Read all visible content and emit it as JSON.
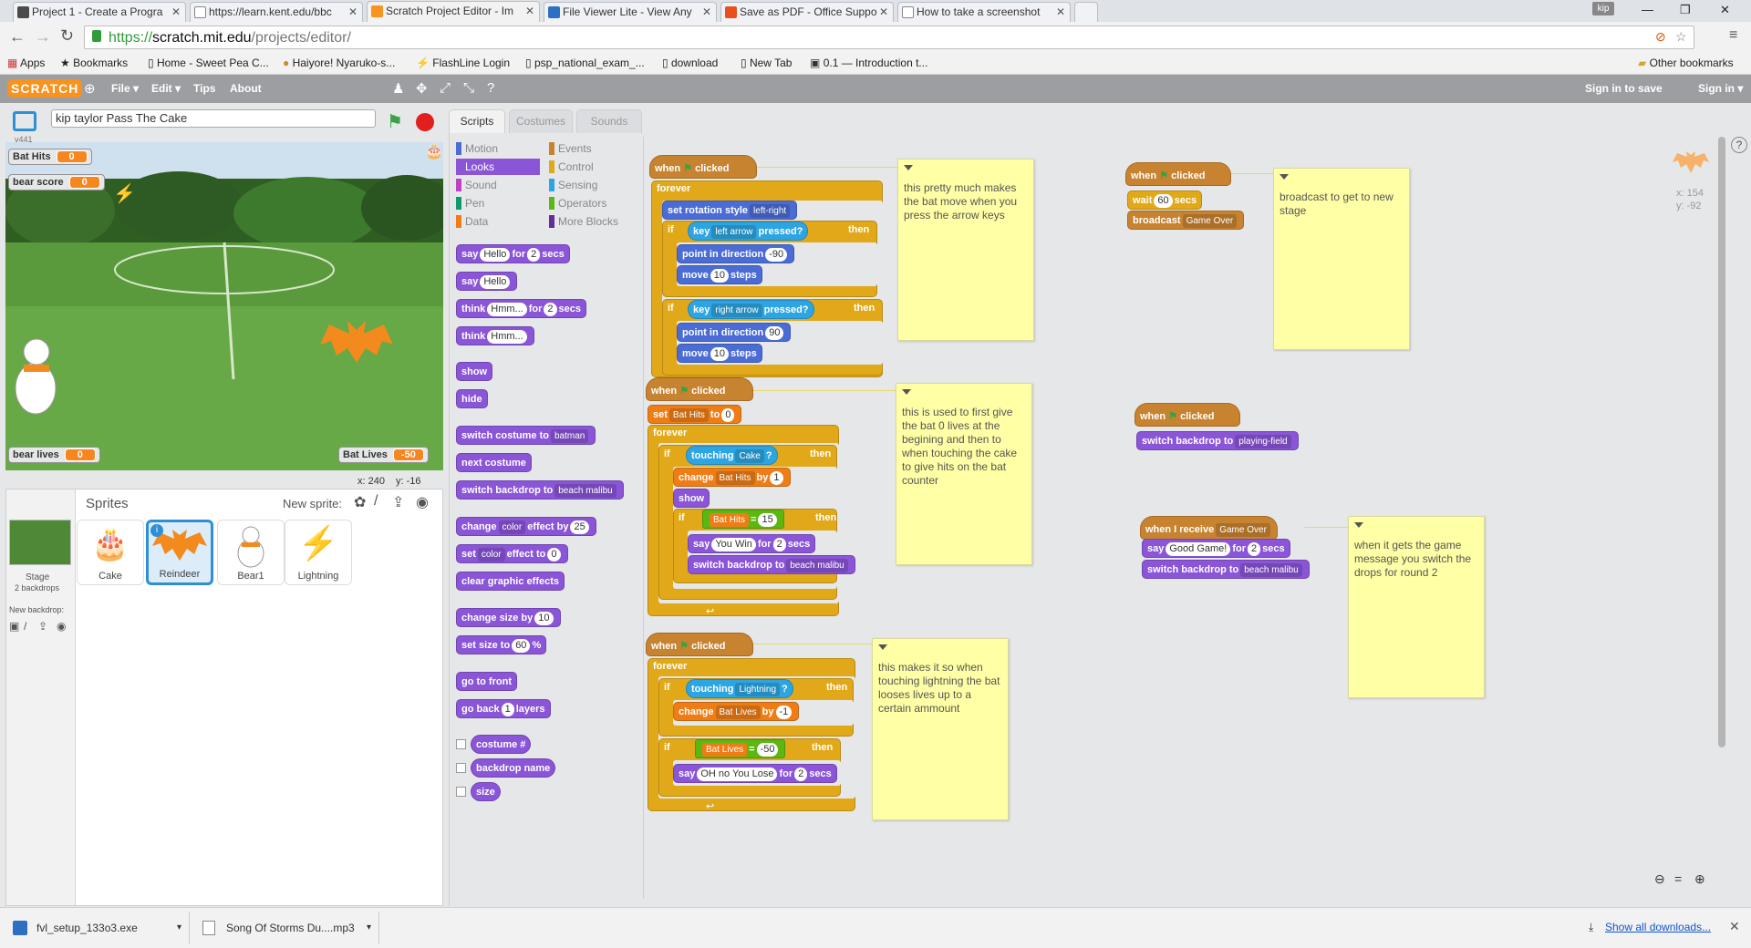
{
  "browser": {
    "tabs": [
      {
        "title": "Project 1 - Create a Progra",
        "fav": "#4a4a4a"
      },
      {
        "title": "https://learn.kent.edu/bbc",
        "fav": "#888"
      },
      {
        "title": "Scratch Project Editor - Im",
        "fav": "#f7931e"
      },
      {
        "title": "File Viewer Lite - View Any",
        "fav": "#2d6fc4"
      },
      {
        "title": "Save as PDF - Office Suppo",
        "fav": "#e8501e"
      },
      {
        "title": "How to take a screenshot",
        "fav": "#888"
      }
    ],
    "user_badge": "kip",
    "url_scheme": "https://",
    "url_host": "scratch.mit.edu",
    "url_path": "/projects/editor/",
    "bookmarks": [
      "Apps",
      "Bookmarks",
      "Home - Sweet Pea C...",
      "Haiyore! Nyaruko-s...",
      "FlashLine Login",
      "psp_national_exam_...",
      "download",
      "New Tab",
      "0.1 — Introduction t..."
    ],
    "other_bookmarks": "Other bookmarks"
  },
  "scratch": {
    "logo": "SCRATCH",
    "menu": [
      "File ▾",
      "Edit ▾",
      "Tips",
      "About"
    ],
    "sign_in_save": "Sign in to save",
    "sign_in": "Sign in ▾",
    "project_title": "kip taylor Pass The Cake",
    "version": "v441",
    "monitors": {
      "bat_hits_label": "Bat Hits",
      "bat_hits_value": "0",
      "bear_score_label": "bear score",
      "bear_score_value": "0",
      "bear_lives_label": "bear lives",
      "bear_lives_value": "0",
      "bat_lives_label": "Bat Lives",
      "bat_lives_value": "-50"
    },
    "stage_coords_x": "x: 240",
    "stage_coords_y": "y: -16",
    "sprites_header": "Sprites",
    "new_sprite": "New sprite:",
    "stage_label": "Stage",
    "stage_backdrops": "2 backdrops",
    "new_backdrop": "New backdrop:",
    "sprites": [
      "Cake",
      "Reindeer",
      "Bear1",
      "Lightning"
    ],
    "tabs": [
      "Scripts",
      "Costumes",
      "Sounds"
    ],
    "categories_left": [
      "Motion",
      "Looks",
      "Sound",
      "Pen",
      "Data"
    ],
    "categories_right": [
      "Events",
      "Control",
      "Sensing",
      "Operators",
      "More Blocks"
    ],
    "cat_colors": {
      "Motion": "#4a6cd4",
      "Looks": "#8a55d7",
      "Sound": "#bb42c3",
      "Pen": "#0e9a6c",
      "Data": "#ee7d16",
      "Events": "#c88330",
      "Control": "#e1a91a",
      "Sensing": "#2ca5e2",
      "Operators": "#5cb712",
      "More Blocks": "#632d99"
    },
    "palette": {
      "say": "say",
      "hello": "Hello",
      "for": "for",
      "two": "2",
      "secs": "secs",
      "think": "think",
      "hmm": "Hmm...",
      "show": "show",
      "hide": "hide",
      "switch_costume": "switch costume to",
      "batman": "batman",
      "next_costume": "next costume",
      "switch_backdrop": "switch backdrop to",
      "beach": "beach malibu",
      "change": "change",
      "color": "color",
      "effect_by": "effect by",
      "n25": "25",
      "set": "set",
      "effect_to": "effect to",
      "n0": "0",
      "clear_effects": "clear graphic effects",
      "change_size": "change size by",
      "n10": "10",
      "set_size": "set size to",
      "n60": "60",
      "pct": "%",
      "go_front": "go to front",
      "go_back": "go back",
      "n1": "1",
      "layers": "layers",
      "costume_num": "costume #",
      "backdrop_name": "backdrop name",
      "size": "size"
    },
    "script1": {
      "when": "when",
      "clicked": "clicked",
      "forever": "forever",
      "set_rotation": "set rotation style",
      "left_right": "left-right",
      "if": "if",
      "key": "key",
      "left_arrow": "left arrow",
      "pressed": "pressed?",
      "then": "then",
      "point_dir": "point in direction",
      "m90": "-90",
      "move": "move",
      "ten": "10",
      "steps": "steps",
      "right_arrow": "right arrow",
      "p90": "90"
    },
    "script2": {
      "set": "set",
      "bat_hits": "Bat Hits",
      "to": "to",
      "zero": "0",
      "touching": "touching",
      "cake": "Cake",
      "q": "?",
      "change": "change",
      "by": "by",
      "one": "1",
      "eq": "=",
      "fifteen": "15",
      "say": "say",
      "you_win": "You Win",
      "for": "for",
      "two": "2",
      "secs": "secs",
      "switch_backdrop": "switch backdrop to",
      "beach": "beach malibu"
    },
    "script3": {
      "lightning": "Lightning",
      "bat_lives": "Bat Lives",
      "m1": "-1",
      "m50": "-50",
      "oh_no": "OH no You Lose"
    },
    "script4": {
      "wait": "wait",
      "sixty": "60",
      "secs": "secs",
      "broadcast": "broadcast",
      "game_over": "Game Over"
    },
    "script5": {
      "switch_backdrop": "switch backdrop to",
      "playing_field": "playing-field"
    },
    "script6": {
      "when_receive": "when I receive",
      "game_over": "Game Over",
      "say": "say",
      "good_game": "Good Game!",
      "for": "for",
      "two": "2",
      "secs": "secs",
      "switch_backdrop": "switch backdrop to",
      "beach": "beach malibu"
    },
    "notes": [
      "this pretty much makes the bat move when you press the arrow keys",
      "this is used to first give the bat 0 lives at the begining and then to when touching the cake to give hits on the bat counter",
      "this makes it so when touching lightning the bat looses lives up to a certain ammount",
      "broadcast to get to new stage",
      "when it gets the game message you switch the drops for round 2"
    ],
    "sprite_xy_x": "x: 154",
    "sprite_xy_y": "y: -92"
  },
  "downloads": {
    "items": [
      "fvl_setup_133o3.exe",
      "Song Of Storms Du....mp3"
    ],
    "show_all": "Show all downloads..."
  }
}
